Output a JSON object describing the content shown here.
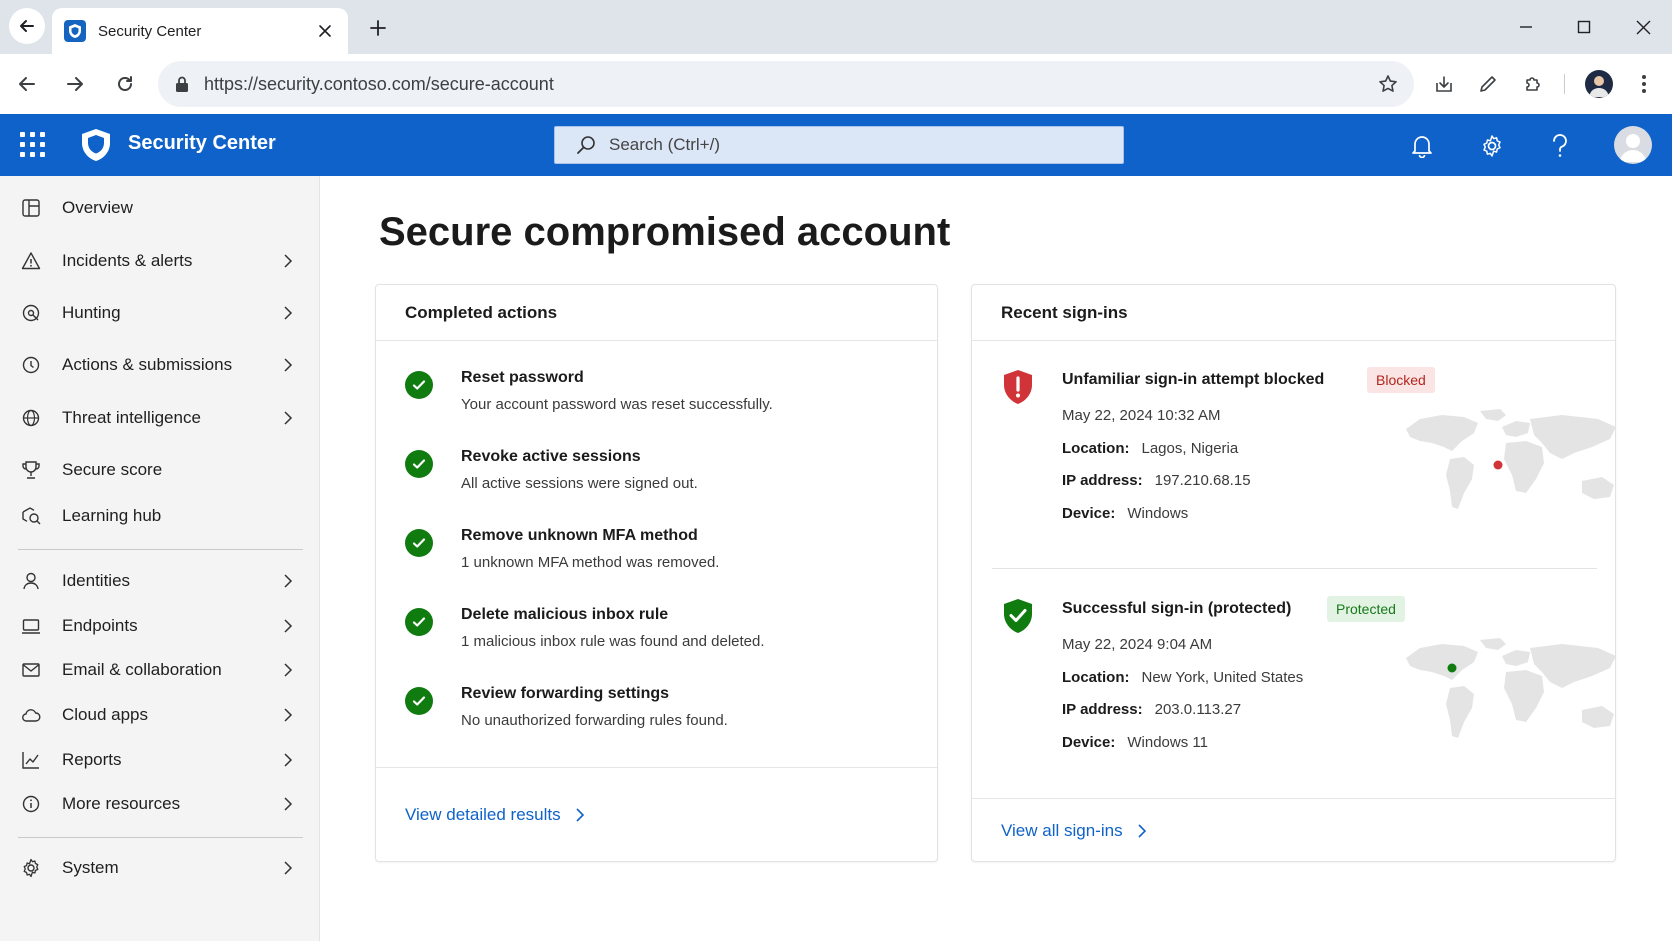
{
  "browser": {
    "tab_title": "Security Center",
    "url": "https://security.contoso.com/secure-account"
  },
  "app": {
    "title": "Security Center",
    "search_placeholder": "Search (Ctrl+/)"
  },
  "sidebar": {
    "items": [
      {
        "label": "Overview",
        "icon": "dashboard-icon",
        "chevron": false
      },
      {
        "label": "Incidents & alerts",
        "icon": "warning-icon",
        "chevron": true
      },
      {
        "label": "Hunting",
        "icon": "hunting-icon",
        "chevron": true
      },
      {
        "label": "Actions & submissions",
        "icon": "actions-icon",
        "chevron": true
      },
      {
        "label": "Threat intelligence",
        "icon": "globe-icon",
        "chevron": true
      },
      {
        "label": "Secure score",
        "icon": "trophy-icon",
        "chevron": false
      },
      {
        "label": "Learning hub",
        "icon": "learning-icon",
        "chevron": false
      },
      {
        "label": "Identities",
        "icon": "person-icon",
        "chevron": true
      },
      {
        "label": "Endpoints",
        "icon": "device-icon",
        "chevron": true
      },
      {
        "label": "Email & collaboration",
        "icon": "mail-icon",
        "chevron": true
      },
      {
        "label": "Cloud apps",
        "icon": "cloud-icon",
        "chevron": true
      },
      {
        "label": "Reports",
        "icon": "chart-icon",
        "chevron": true
      },
      {
        "label": "More resources",
        "icon": "info-icon",
        "chevron": true
      },
      {
        "label": "System",
        "icon": "gear-icon",
        "chevron": true
      }
    ]
  },
  "main": {
    "page_title": "Secure compromised account",
    "completed": {
      "title": "Completed actions",
      "actions": [
        {
          "title": "Reset password",
          "desc": "Your account password was reset successfully."
        },
        {
          "title": "Revoke active sessions",
          "desc": "All active sessions were signed out."
        },
        {
          "title": "Remove unknown MFA method",
          "desc": "1 unknown MFA method was removed."
        },
        {
          "title": "Delete malicious inbox rule",
          "desc": "1 malicious inbox rule was found and deleted."
        },
        {
          "title": "Review forwarding settings",
          "desc": "No unauthorized forwarding rules found."
        }
      ],
      "footer_link": "View detailed results"
    },
    "signins": {
      "title": "Recent sign-ins",
      "labels": {
        "location": "Location:",
        "ip": "IP address:",
        "device": "Device:"
      },
      "items": [
        {
          "title": "Unfamiliar sign-in attempt blocked",
          "badge": "Blocked",
          "status": "blocked",
          "date": "May 22, 2024 10:32 AM",
          "location": "Lagos, Nigeria",
          "ip": "197.210.68.15",
          "device": "Windows",
          "marker_color": "#d13438"
        },
        {
          "title": "Successful sign-in (protected)",
          "badge": "Protected",
          "status": "protected",
          "date": "May 22, 2024 9:04 AM",
          "location": "New York, United States",
          "ip": "203.0.113.27",
          "device": "Windows 11",
          "marker_color": "#107c10"
        }
      ],
      "footer_link": "View all sign-ins"
    }
  },
  "colors": {
    "brand": "#0f62c9",
    "success": "#107c10",
    "danger": "#d13438"
  }
}
